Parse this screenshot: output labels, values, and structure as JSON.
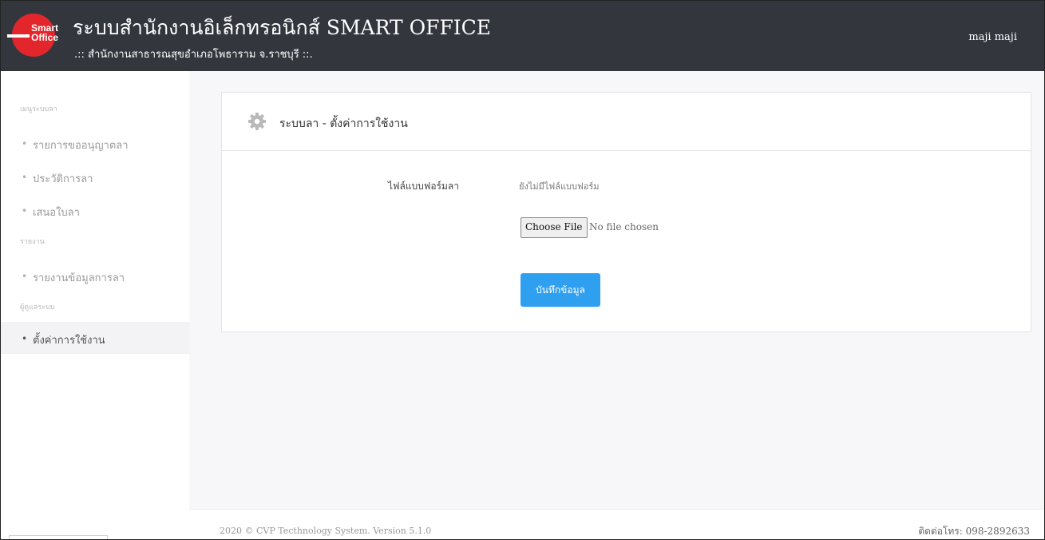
{
  "header": {
    "logo_line1": "Smart",
    "logo_line2": "Office",
    "title": "ระบบสำนักงานอิเล็กทรอนิกส์ SMART OFFICE",
    "subtitle": ".:: สำนักงานสาธารณสุขอำเภอโพธาราม จ.ราชบุรี ::.",
    "user": "maji maji"
  },
  "sidebar": {
    "sections": [
      {
        "label": "เมนูระบบลา"
      },
      {
        "label": "รายงาน"
      },
      {
        "label": "ผู้ดูแลระบบ"
      }
    ],
    "items": [
      {
        "label": "รายการขออนุญาตลา",
        "active": false
      },
      {
        "label": "ประวัติการลา",
        "active": false
      },
      {
        "label": "เสนอใบลา",
        "active": false
      },
      {
        "label": "รายงานข้อมูลการลา",
        "active": false
      },
      {
        "label": "ตั้งค่าการใช้งาน",
        "active": true
      }
    ],
    "bullet": "•"
  },
  "panel": {
    "title": "ระบบลา - ตั้งค่าการใช้งาน",
    "icon": "gear-icon",
    "form_label": "ไฟล์แบบฟอร์มลา",
    "form_value": "ยังไม่มีไฟล์แบบฟอร์ม",
    "choose_file": "Choose File",
    "no_file": "No file chosen",
    "save": "บันทึกข้อมูล"
  },
  "footer": {
    "copyright": "2020 © CVP Tecthnology System. Version 5.1.0",
    "contact": "ติดต่อโทร: 098-2892633"
  },
  "colors": {
    "topbar": "#33373d",
    "logo": "#e3262c",
    "primary_button": "#2f9ff0"
  }
}
